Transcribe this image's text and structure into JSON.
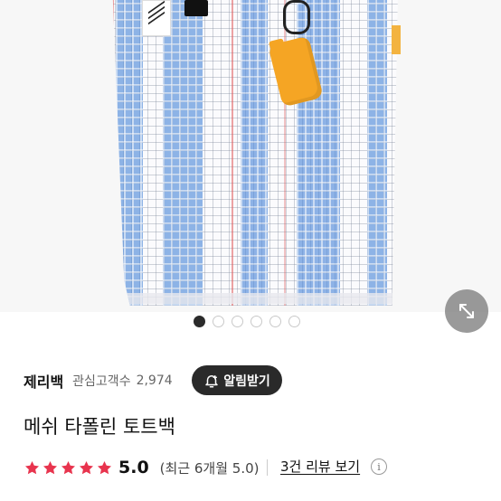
{
  "carousel": {
    "total": 6,
    "active_index": 0
  },
  "store": {
    "name": "제리백",
    "interest_label": "관심고객수",
    "interest_count": "2,974",
    "alarm_button": "알림받기"
  },
  "product": {
    "title": "메쉬 타폴린 토트백"
  },
  "rating": {
    "stars": 5,
    "score": "5.0",
    "recent": "(최근 6개월 5.0)",
    "review_link": "3건 리뷰 보기",
    "info_icon": "i"
  },
  "colors": {
    "star": "#e8344e",
    "alarm_bg": "#2a2a2a",
    "active_dot": "#2b2b2b"
  },
  "icons": {
    "expand": "expand-arrows-icon",
    "bell": "bell-plus-icon",
    "info": "info-icon",
    "star": "star-icon"
  }
}
